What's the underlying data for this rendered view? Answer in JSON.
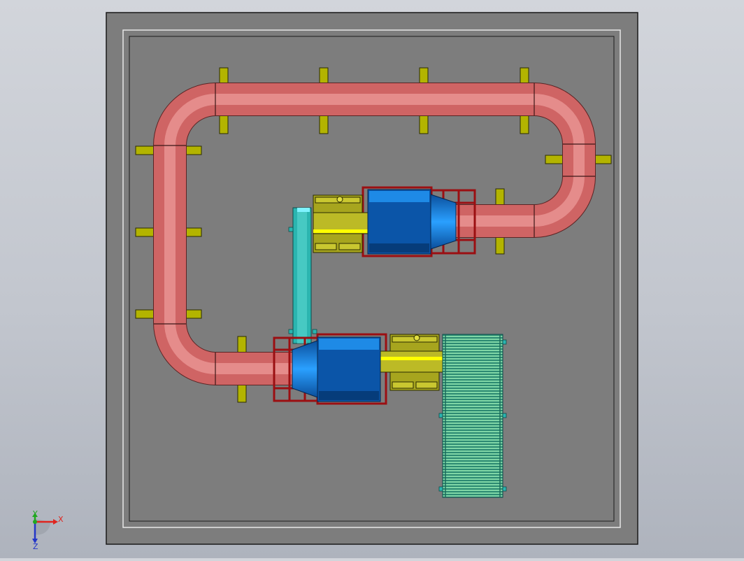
{
  "view": {
    "background_top": "#d2d5db",
    "background_bottom": "#aeb3bd"
  },
  "model": {
    "plate_color": "#7d7d7d",
    "outline_color": "#1a1a1a",
    "frame_line_color": "#e6e6e6",
    "duct_color": "#d9706f",
    "duct_highlight": "#f3a3a0",
    "duct_shadow": "#8e3b3c",
    "support_color": "#b3b400",
    "fan_body_color": "#0b55a8",
    "fan_inlet_color": "#1d7fe0",
    "fan_base_color": "#9b0f12",
    "motor_color": "#a7a51e",
    "shaft_color": "#ffff00",
    "pipe_color": "#2bb5b0",
    "grating_color": "#35a68a"
  },
  "triad": {
    "x_label": "X",
    "y_label": "Y",
    "z_label": "Z",
    "x_color": "#e0251f",
    "y_color": "#1fa81f",
    "z_color": "#2436c8"
  }
}
